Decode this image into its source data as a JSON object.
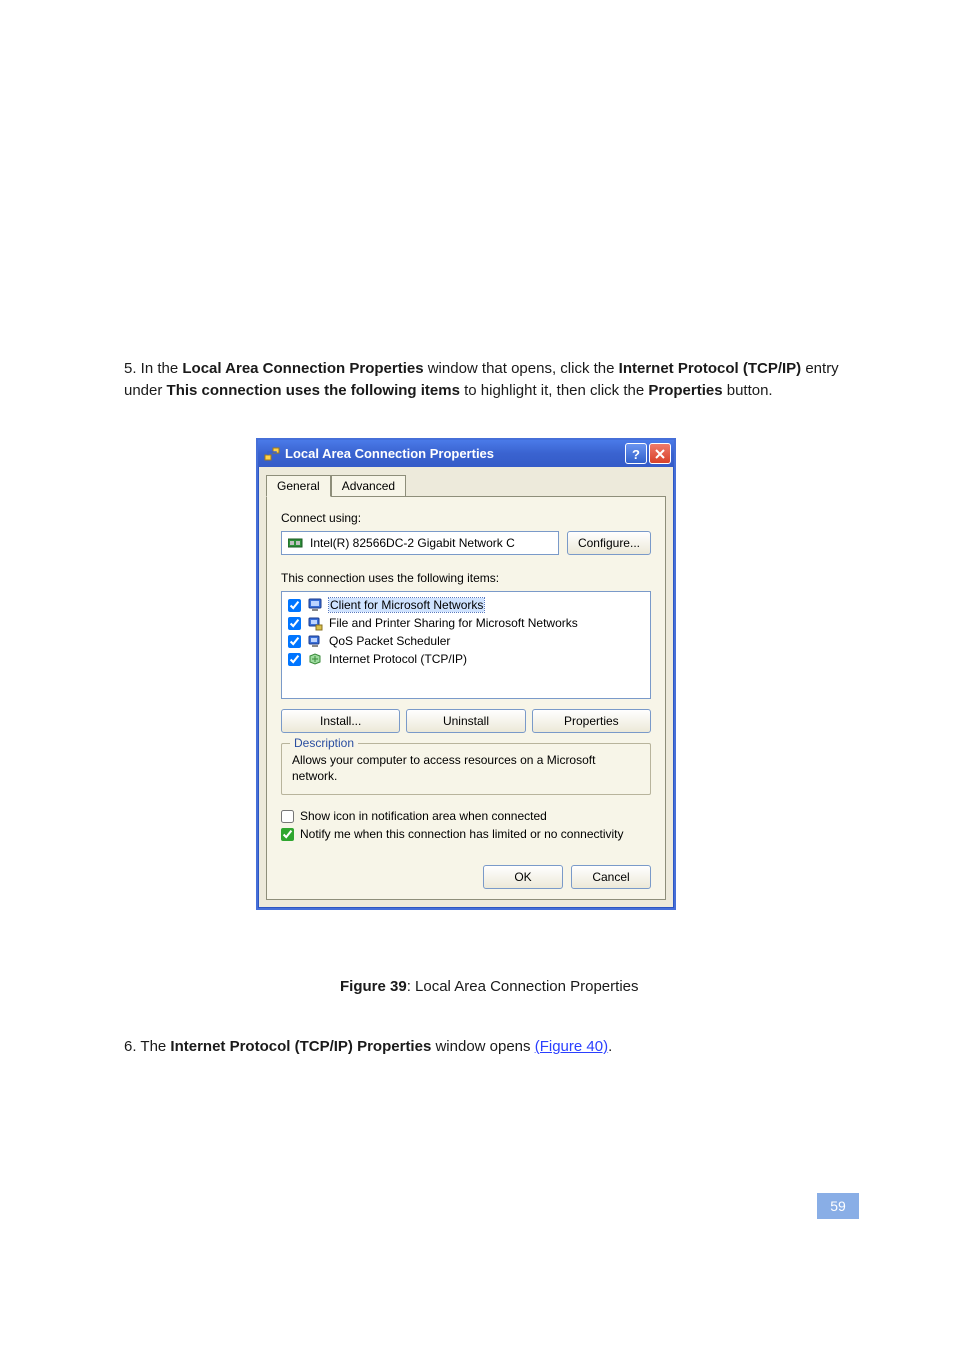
{
  "doc": {
    "intro_1a": "5. In the ",
    "intro_1b": " window that opens, click the ",
    "intro_1c": " entry under ",
    "intro_1d": " to highlight it, then click the ",
    "intro_1e": " button.",
    "term_lac": "Local Area Connection Properties",
    "term_tcpip": "Internet Protocol (TCP/IP)",
    "term_items": "This connection uses the following items",
    "term_props": "Properties",
    "fig_caption_a": "Figure 39",
    "fig_caption_b": ": Local Area Connection Properties",
    "outro_1": "6. The ",
    "outro_term": "Internet Protocol (TCP/IP) Properties",
    "outro_2": " window opens ",
    "outro_link": "(Figure 40)",
    "outro_3": ".",
    "page_num": "59"
  },
  "dialog": {
    "title": "Local Area Connection Properties",
    "tabs": {
      "general": "General",
      "advanced": "Advanced"
    },
    "connect_using": "Connect using:",
    "nic_name": "Intel(R) 82566DC-2 Gigabit Network C",
    "configure": "Configure...",
    "items_label": "This connection uses the following items:",
    "items": [
      {
        "label": "Client for Microsoft Networks",
        "checked": true
      },
      {
        "label": "File and Printer Sharing for Microsoft Networks",
        "checked": true
      },
      {
        "label": "QoS Packet Scheduler",
        "checked": true
      },
      {
        "label": "Internet Protocol (TCP/IP)",
        "checked": true
      }
    ],
    "btn_install": "Install...",
    "btn_uninstall": "Uninstall",
    "btn_properties": "Properties",
    "desc_legend": "Description",
    "desc_text": "Allows your computer to access resources on a Microsoft network.",
    "chk_show_icon": "Show icon in notification area when connected",
    "chk_notify": "Notify me when this connection has limited or no connectivity",
    "btn_ok": "OK",
    "btn_cancel": "Cancel"
  }
}
